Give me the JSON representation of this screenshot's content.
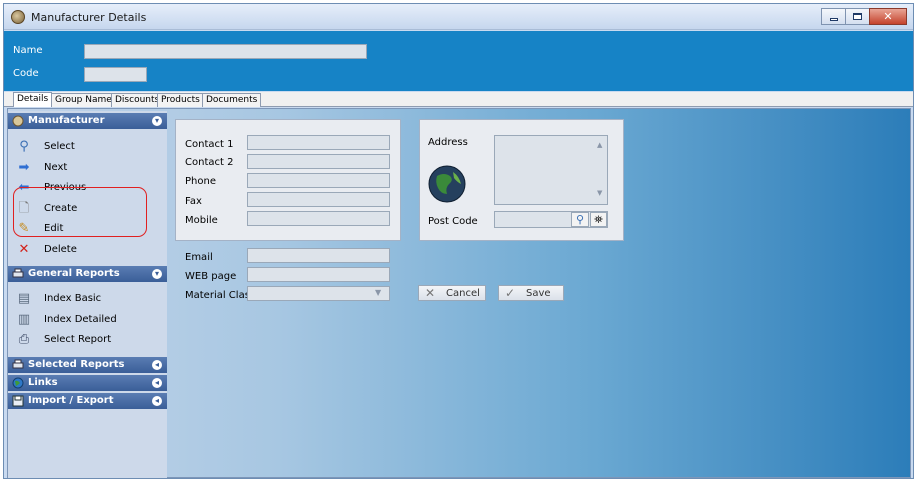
{
  "window": {
    "title": "Manufacturer Details"
  },
  "header": {
    "name_label": "Name",
    "code_label": "Code",
    "name_value": "",
    "code_value": ""
  },
  "tabs": [
    "Details",
    "Group Names",
    "Discounts",
    "Products",
    "Documents"
  ],
  "sidebar": {
    "manufacturer": {
      "title": "Manufacturer",
      "items": [
        "Select",
        "Next",
        "Previous",
        "Create",
        "Edit",
        "Delete"
      ]
    },
    "general_reports": {
      "title": "General Reports",
      "items": [
        "Index Basic",
        "Index Detailed",
        "Select Report"
      ]
    },
    "selected_reports": {
      "title": "Selected Reports"
    },
    "links": {
      "title": "Links"
    },
    "import_export": {
      "title": "Import / Export"
    }
  },
  "form": {
    "contact1_label": "Contact 1",
    "contact2_label": "Contact 2",
    "phone_label": "Phone",
    "fax_label": "Fax",
    "mobile_label": "Mobile",
    "email_label": "Email",
    "web_label": "WEB page",
    "material_label": "Material Class",
    "address_label": "Address",
    "postcode_label": "Post Code",
    "contact1": "",
    "contact2": "",
    "phone": "",
    "fax": "",
    "mobile": "",
    "email": "",
    "web": "",
    "material_class": "",
    "address": "",
    "postcode": ""
  },
  "buttons": {
    "cancel": "Cancel",
    "save": "Save"
  }
}
